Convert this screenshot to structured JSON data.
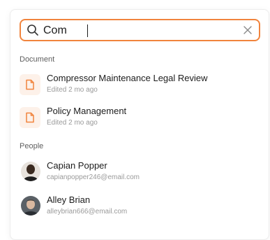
{
  "search": {
    "value": "Com",
    "placeholder": ""
  },
  "sections": {
    "documents": {
      "label": "Document",
      "items": [
        {
          "title": "Compressor Maintenance Legal Review",
          "subtitle": "Edited 2 mo ago",
          "icon": "document-icon"
        },
        {
          "title": "Policy Management",
          "subtitle": "Edited 2 mo ago",
          "icon": "document-icon"
        }
      ]
    },
    "people": {
      "label": "People",
      "items": [
        {
          "name": "Capian Popper",
          "email": "capianpopper246@email.com",
          "icon": "avatar"
        },
        {
          "name": "Alley Brian",
          "email": "alleybrian666@email.com",
          "icon": "avatar"
        }
      ]
    }
  },
  "colors": {
    "accent": "#f1843d",
    "doc_icon_bg": "#fdf1e9"
  }
}
